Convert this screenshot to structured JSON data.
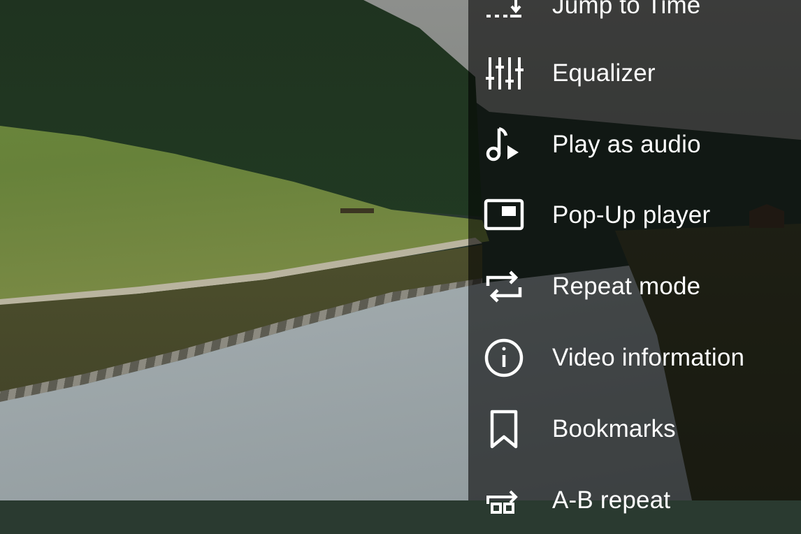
{
  "menu": {
    "items": [
      {
        "label": "Jump to Time",
        "icon": "jump-to-time-icon"
      },
      {
        "label": "Equalizer",
        "icon": "equalizer-icon"
      },
      {
        "label": "Play as audio",
        "icon": "music-note-play-icon"
      },
      {
        "label": "Pop-Up player",
        "icon": "picture-in-picture-icon"
      },
      {
        "label": "Repeat mode",
        "icon": "repeat-icon"
      },
      {
        "label": "Video information",
        "icon": "info-icon"
      },
      {
        "label": "Bookmarks",
        "icon": "bookmark-icon"
      },
      {
        "label": "A-B repeat",
        "icon": "ab-repeat-icon"
      }
    ]
  }
}
